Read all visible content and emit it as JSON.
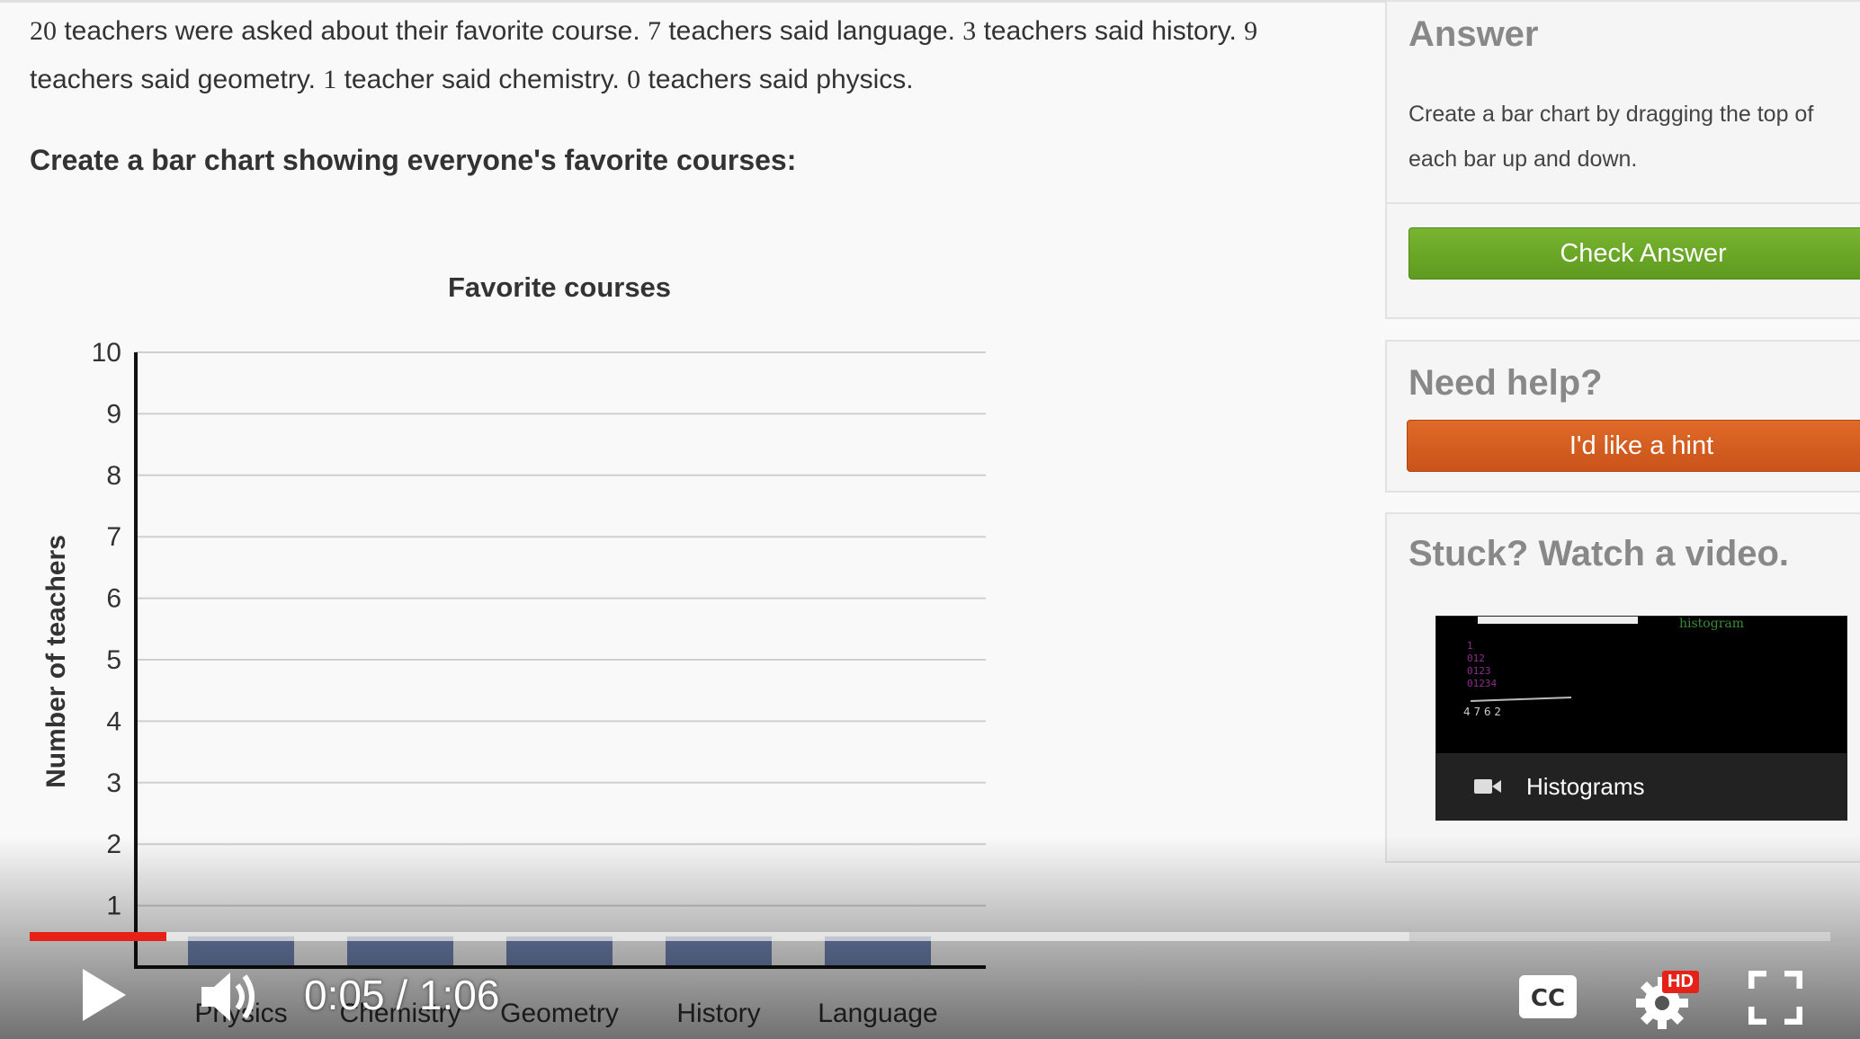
{
  "problem": {
    "p1_num": "20",
    "p1_text": " teachers were asked about their favorite course. ",
    "p2_num": "7",
    "p2_text": " teachers said language. ",
    "p3_num": "3",
    "p3_text": " teachers said history. ",
    "p4_num": "9",
    "p4_text": " teachers said geometry. ",
    "p5_num": "1",
    "p5_text": " teacher said chemistry. ",
    "p6_num": "0",
    "p6_text": " teachers said physics."
  },
  "instruction": "Create a bar chart showing everyone's favorite courses:",
  "chart_data": {
    "type": "bar",
    "title": "Favorite courses",
    "xlabel": "",
    "ylabel": "Number of teachers",
    "categories": [
      "Physics",
      "Chemistry",
      "Geometry",
      "History",
      "Language"
    ],
    "values": [
      0.5,
      0.5,
      0.5,
      0.5,
      0.5
    ],
    "ylim": [
      0,
      10
    ],
    "yticks": [
      "1",
      "2",
      "3",
      "4",
      "5",
      "6",
      "7",
      "8",
      "9",
      "10"
    ],
    "bar_color": "#7285b3",
    "grid": true
  },
  "sidebar": {
    "answer_title": "Answer",
    "answer_desc": "Create a bar chart by dragging the top of each bar up and down.",
    "check_button": "Check Answer",
    "help_title": "Need help?",
    "hint_button": "I'd like a hint",
    "video_title": "Stuck? Watch a video.",
    "video_label": "Histograms",
    "check_color": "#6aa624",
    "hint_color": "#d65e20"
  },
  "player": {
    "time": "0:05 / 1:06",
    "played_fraction": 0.076,
    "buffered_fraction": 0.766,
    "progress_color": "#e62117",
    "hd_badge": "HD",
    "cc_label": "CC",
    "icons": [
      "play-icon",
      "volume-icon",
      "cc-icon",
      "settings-icon",
      "fullscreen-icon"
    ]
  }
}
